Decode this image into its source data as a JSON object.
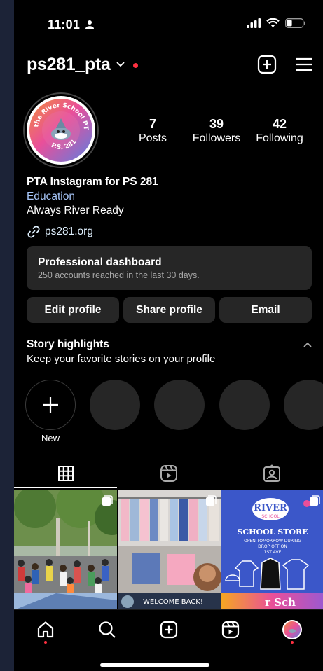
{
  "status": {
    "time": "11:01"
  },
  "header": {
    "username": "ps281_pta"
  },
  "profile": {
    "avatar_text_top": "the River School PTA",
    "avatar_text_bottom": "P.S. 281",
    "stats": [
      {
        "value": "7",
        "label": "Posts"
      },
      {
        "value": "39",
        "label": "Followers"
      },
      {
        "value": "42",
        "label": "Following"
      }
    ],
    "name": "PTA Instagram for PS 281",
    "category": "Education",
    "bio": "Always River Ready",
    "link": "ps281.org"
  },
  "dashboard": {
    "title": "Professional dashboard",
    "subtitle": "250 accounts reached in the last 30 days."
  },
  "buttons": {
    "edit": "Edit profile",
    "share": "Share profile",
    "email": "Email"
  },
  "highlights": {
    "title": "Story highlights",
    "subtitle": "Keep your favorite stories on your profile",
    "new_label": "New"
  },
  "posts": {
    "store_brand": "RIVER",
    "store_brand_sub": "SCHOOL",
    "store_title": "SCHOOL STORE",
    "store_line1": "OPEN TOMORROW DURING",
    "store_line2": "DROP OFF ON",
    "store_line3": "1ST AVE",
    "welcome": "WELCOME BACK!",
    "partial_text": "r Sch"
  },
  "colors": {
    "accent_red": "#ff3040",
    "surface": "#262626",
    "store_blue": "#3b57c9"
  }
}
